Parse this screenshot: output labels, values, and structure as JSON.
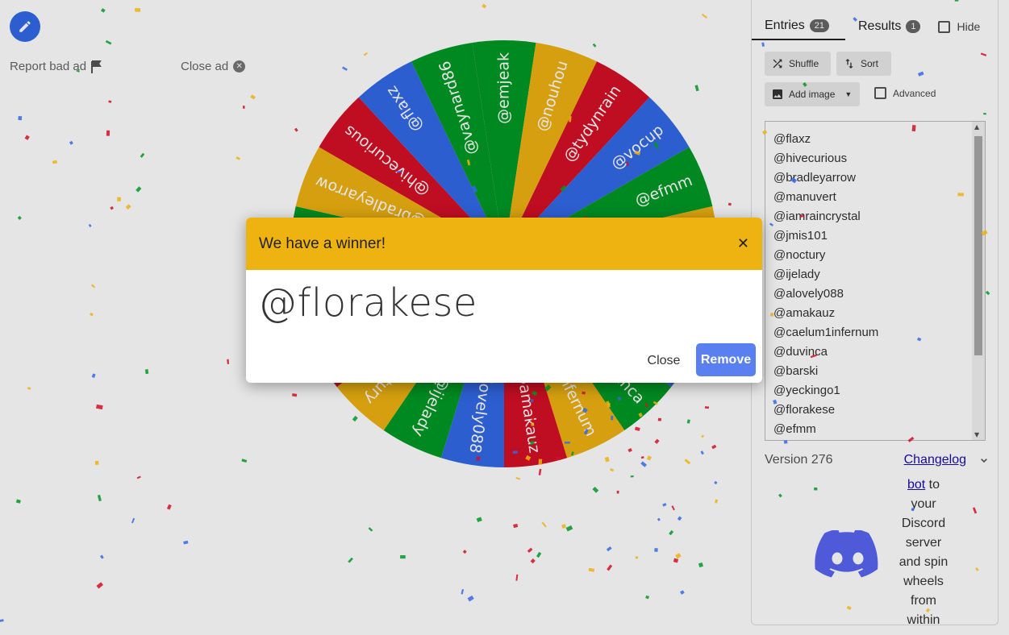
{
  "ads": {
    "report_label": "Report bad ad",
    "close_label": "Close ad"
  },
  "wheel": {
    "colors": [
      "#009925",
      "#eeb211",
      "#d50f25",
      "#3369e8"
    ],
    "labels": [
      "@emjeak",
      "@nouhou",
      "@tydynrain",
      "@vocup",
      "@efmm",
      "@florakese",
      "@yeckingo1",
      "@barski",
      "@duvinca",
      "@caelum1infernum",
      "@amakauz",
      "@alovely088",
      "@ijelady",
      "@noctury",
      "@jmis101",
      "@iamraincrystal",
      "@manuvert",
      "@bradleyarrow",
      "@hivecurious",
      "@flaxz",
      "@vaynard86"
    ]
  },
  "tabs": {
    "entries_label": "Entries",
    "entries_count": "21",
    "results_label": "Results",
    "results_count": "1",
    "hide_label": "Hide"
  },
  "toolbar": {
    "shuffle_label": "Shuffle",
    "sort_label": "Sort",
    "add_image_label": "Add image",
    "advanced_label": "Advanced"
  },
  "entries": [
    "@flaxz",
    "@hivecurious",
    "@bradleyarrow",
    "@manuvert",
    "@iamraincrystal",
    "@jmis101",
    "@noctury",
    "@ijelady",
    "@alovely088",
    "@amakauz",
    "@caelum1infernum",
    "@duvinca",
    "@barski",
    "@yeckingo1",
    "@florakese",
    "@efmm"
  ],
  "footer": {
    "version": "Version 276",
    "changelog": "Changelog",
    "discord_bot": "bot",
    "discord_lines": [
      "to",
      "your",
      "Discord",
      "server",
      "and spin",
      "wheels",
      "from",
      "within"
    ]
  },
  "dialog": {
    "title": "We have a winner!",
    "winner": "@florakese",
    "close_label": "Close",
    "remove_label": "Remove"
  }
}
